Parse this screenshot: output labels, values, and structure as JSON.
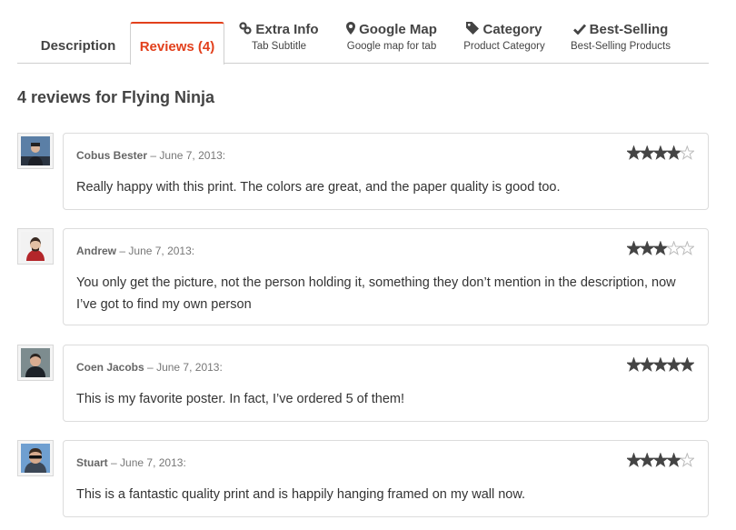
{
  "tabs": [
    {
      "id": "description",
      "label": "Description",
      "active": false
    },
    {
      "id": "reviews",
      "label": "Reviews (4)",
      "active": true
    },
    {
      "id": "extra-info",
      "label": "Extra Info",
      "subtitle": "Tab Subtitle",
      "icon": "link-icon"
    },
    {
      "id": "google-map",
      "label": "Google Map",
      "subtitle": "Google map for tab",
      "icon": "map-marker-icon"
    },
    {
      "id": "category",
      "label": "Category",
      "subtitle": "Product Category",
      "icon": "tag-icon"
    },
    {
      "id": "best-selling",
      "label": "Best-Selling",
      "subtitle": "Best-Selling Products",
      "icon": "check-icon"
    }
  ],
  "reviews_heading": "4 reviews for Flying Ninja",
  "reviews": [
    {
      "author": "Cobus Bester",
      "separator": "–",
      "date": "June 7, 2013:",
      "rating": 4,
      "max_rating": 5,
      "text": "Really happy with this print. The colors are great, and the paper quality is good too."
    },
    {
      "author": "Andrew",
      "separator": "–",
      "date": "June 7, 2013:",
      "rating": 3,
      "max_rating": 5,
      "text": "You only get the picture, not the person holding it, something they don’t mention in the description, now I’ve got to find my own person"
    },
    {
      "author": "Coen Jacobs",
      "separator": "–",
      "date": "June 7, 2013:",
      "rating": 5,
      "max_rating": 5,
      "text": "This is my favorite poster. In fact, I’ve ordered 5 of them!"
    },
    {
      "author": "Stuart",
      "separator": "–",
      "date": "June 7, 2013:",
      "rating": 4,
      "max_rating": 5,
      "text": "This is a fantastic quality print and is happily hanging framed on my wall now."
    }
  ],
  "colors": {
    "accent": "#e2401c",
    "star": "#444444",
    "star_empty": "#bbbbbb"
  }
}
